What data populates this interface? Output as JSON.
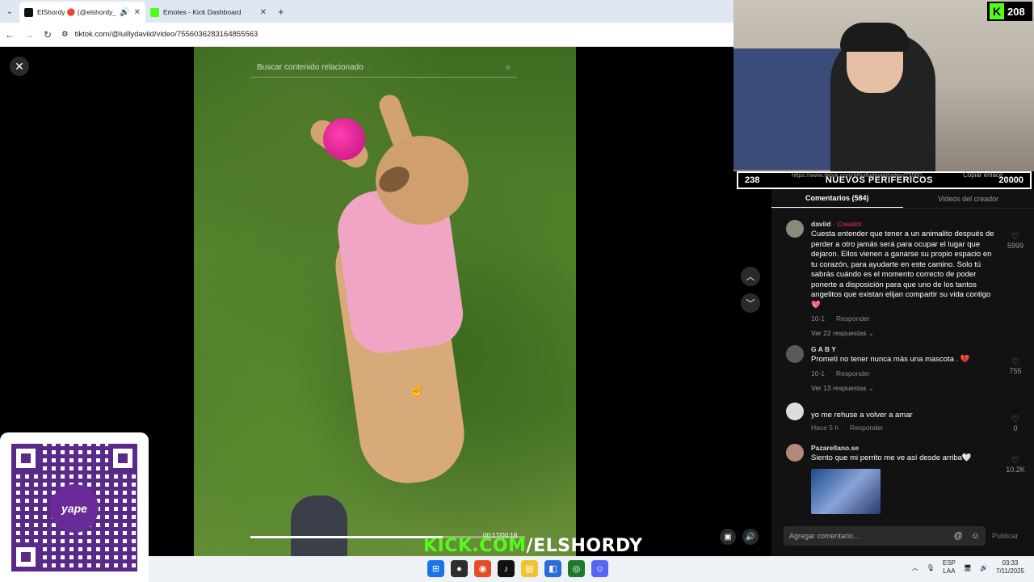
{
  "browser": {
    "tabs": [
      {
        "title": "ElShordy 🔴 (@elshordy_)",
        "favicon_color": "#111111",
        "active": true
      },
      {
        "title": "Emotes - Kick Dashboard",
        "favicon_color": "#53fc18",
        "active": false
      }
    ],
    "url": "tiktok.com/@luillydaviid/video/7556036283164855563"
  },
  "video": {
    "search_placeholder": "Buscar contenido relacionado",
    "time": "00:17/00:18",
    "progress": 0.7
  },
  "brand_overlay": {
    "prefix": "KICK.COM",
    "suffix": "/ELSHORDY"
  },
  "qr": {
    "logo_text": "yape"
  },
  "stream": {
    "viewers": "208",
    "goal_left": "238",
    "goal_title": "NUEVOS PERIFERICOS",
    "goal_right": "20000",
    "link_text": "https://www.tiktok.com/@luillydaviid/video/75560...",
    "copy_link": "Copiar enlace"
  },
  "panel": {
    "tabs": [
      "Comentarios (584)",
      "Videos del creador"
    ],
    "comments": [
      {
        "name": "daviid",
        "creator_tag": " · Creador",
        "text": "Cuesta entender que tener a un animalito después de perder a otro jamás será para ocupar el lugar que dejaron. Ellos vienen a ganarse su propio espacio en tu corazón, para ayudarte en este camino. Solo tú sabrás cuándo es el momento correcto de poder ponerte a disposición para que uno de los tantos angelitos que existan elijan compartir su vida contigo 💖",
        "date": "10-1",
        "reply": "Responder",
        "replies": "Ver 22 respuestas ⌄",
        "likes": "5999"
      },
      {
        "name": "G A B Y",
        "creator_tag": "",
        "text": "Prometí no tener nunca más una mascota . 💔",
        "date": "10-1",
        "reply": "Responder",
        "replies": "Ver 13 respuestas ⌄",
        "likes": "755"
      },
      {
        "name": "",
        "creator_tag": "",
        "text": "yo me rehuse a volver a amar",
        "date": "Hace 5 h",
        "reply": "Responder",
        "replies": "",
        "likes": "0"
      },
      {
        "name": "Pazarellano.se",
        "creator_tag": "",
        "text": "Siento que mi perrito me ve así desde arriba🤍",
        "date": "",
        "reply": "",
        "replies": "",
        "likes": "10.2K"
      }
    ],
    "composer_placeholder": "Agregar comentario...",
    "publish": "Publicar"
  },
  "taskbar": {
    "lang_top": "ESP",
    "lang_bottom": "LAA",
    "time": "03:33",
    "date": "7/11/2025"
  }
}
